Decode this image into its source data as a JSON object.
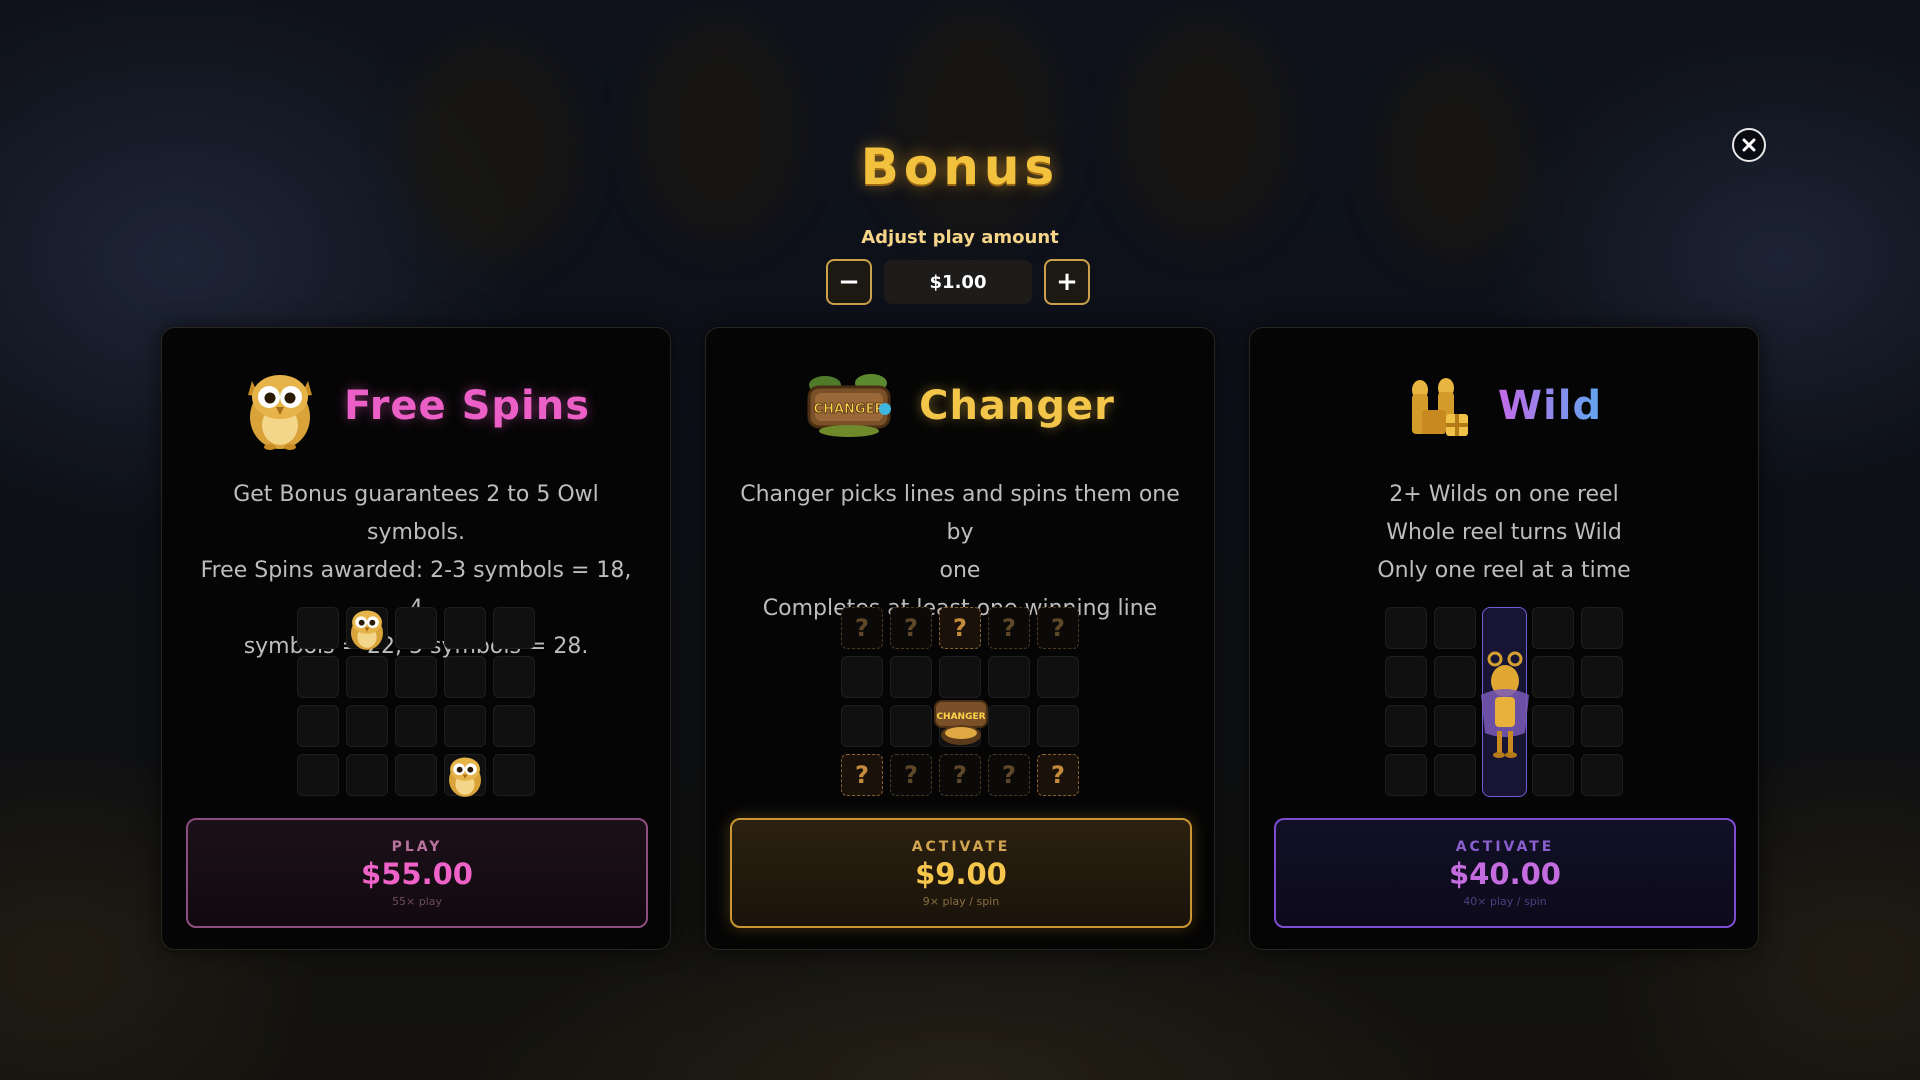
{
  "header": {
    "title": "Bonus",
    "adjust_label": "Adjust play amount",
    "amount": "$1.00",
    "minus_label": "−",
    "plus_label": "+"
  },
  "cards": [
    {
      "title": "Free Spins",
      "icon": "owl-icon",
      "desc": [
        "Get Bonus guarantees 2 to 5 Owl symbols.",
        "Free Spins awarded: 2-3 symbols = 18, 4",
        "symbols = 22, 5 symbols = 28."
      ],
      "action_label": "PLAY",
      "price": "$55.00",
      "sub": "55× play"
    },
    {
      "title": "Changer",
      "icon": "changer-sign-icon",
      "desc": [
        "Changer picks lines and spins them one by",
        "one",
        "Completes at least one winning line"
      ],
      "action_label": "ACTIVATE",
      "price": "$9.00",
      "sub": "9× play / spin",
      "sign_text": "CHANGER",
      "question_mark": "?"
    },
    {
      "title": "Wild",
      "icon": "gold-stack-icon",
      "desc": [
        "2+ Wilds on one reel",
        "Whole reel turns Wild",
        "Only one reel at a time"
      ],
      "action_label": "ACTIVATE",
      "price": "$40.00",
      "sub": "40× play / spin"
    }
  ],
  "colors": {
    "gold": "#f2c23e",
    "pink": "#ec5fc6",
    "purple": "#7d4cd0"
  }
}
